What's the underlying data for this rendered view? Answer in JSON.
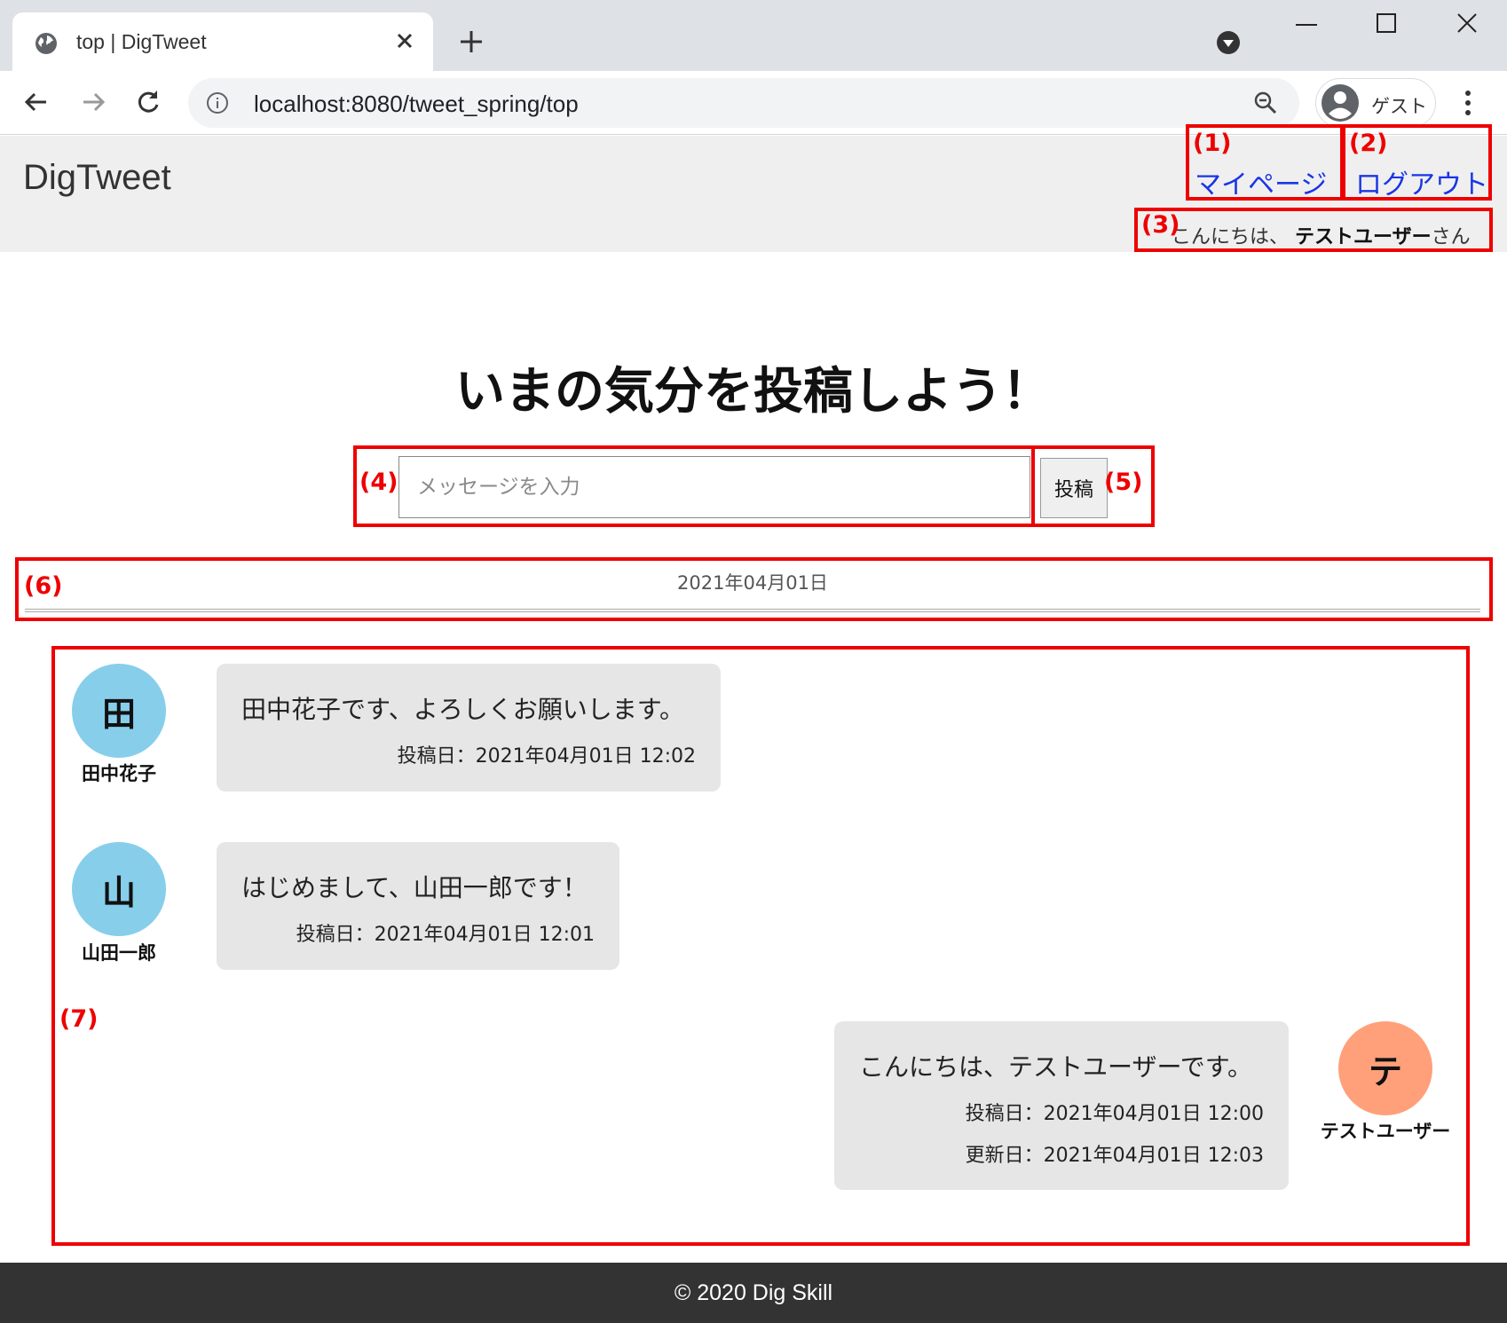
{
  "browser": {
    "tab_title": "top | DigTweet",
    "url": "localhost:8080/tweet_spring/top",
    "profile_label": "ゲスト"
  },
  "header": {
    "logo": "DigTweet",
    "mypage_link": "マイページ",
    "logout_link": "ログアウト",
    "greeting_prefix": "こんにちは、",
    "greeting_user": "テストユーザー",
    "greeting_suffix": "さん"
  },
  "main": {
    "heading": "いまの気分を投稿しよう！",
    "input_placeholder": "メッセージを入力",
    "post_button": "投稿",
    "date_separator": "2021年04月01日"
  },
  "posts": [
    {
      "avatar_char": "田",
      "avatar_color": "#87ceeb",
      "user": "田中花子",
      "text": "田中花子です、よろしくお願いします。",
      "posted": "投稿日：2021年04月01日 12:02"
    },
    {
      "avatar_char": "山",
      "avatar_color": "#87ceeb",
      "user": "山田一郎",
      "text": "はじめまして、山田一郎です！",
      "posted": "投稿日：2021年04月01日 12:01"
    },
    {
      "avatar_char": "テ",
      "avatar_color": "#ffa07a",
      "user": "テストユーザー",
      "text": "こんにちは、テストユーザーです。",
      "posted": "投稿日：2021年04月01日 12:00",
      "updated": "更新日：2021年04月01日 12:03"
    }
  ],
  "annotations": [
    "(1)",
    "(2)",
    "(3)",
    "(4)",
    "(5)",
    "(6)",
    "(7)"
  ],
  "footer": {
    "copyright": "© 2020 Dig Skill"
  },
  "colors": {
    "annotation": "#ee0000",
    "link": "#1a35e6",
    "footer_bg": "#333333",
    "header_bg": "#efefef"
  }
}
